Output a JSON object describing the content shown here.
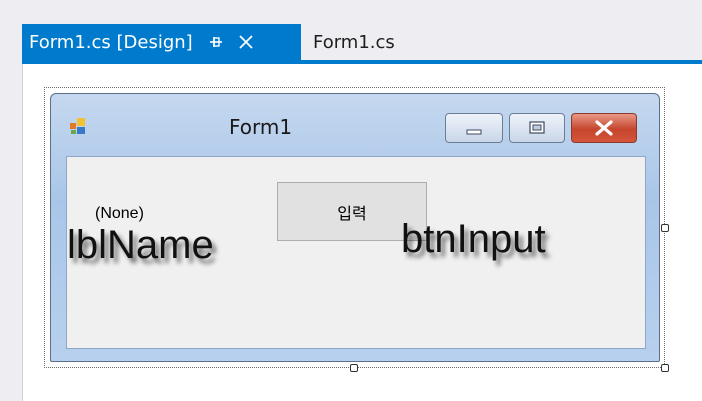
{
  "tabs": {
    "active_label": "Form1.cs [Design]",
    "inactive_label": "Form1.cs"
  },
  "form": {
    "title": "Form1",
    "button_label": "입력",
    "label_text": "(None)",
    "label_name": "lblName",
    "button_name": "btnInput"
  },
  "colors": {
    "accent": "#007acc",
    "close_button": "#c6452e"
  }
}
